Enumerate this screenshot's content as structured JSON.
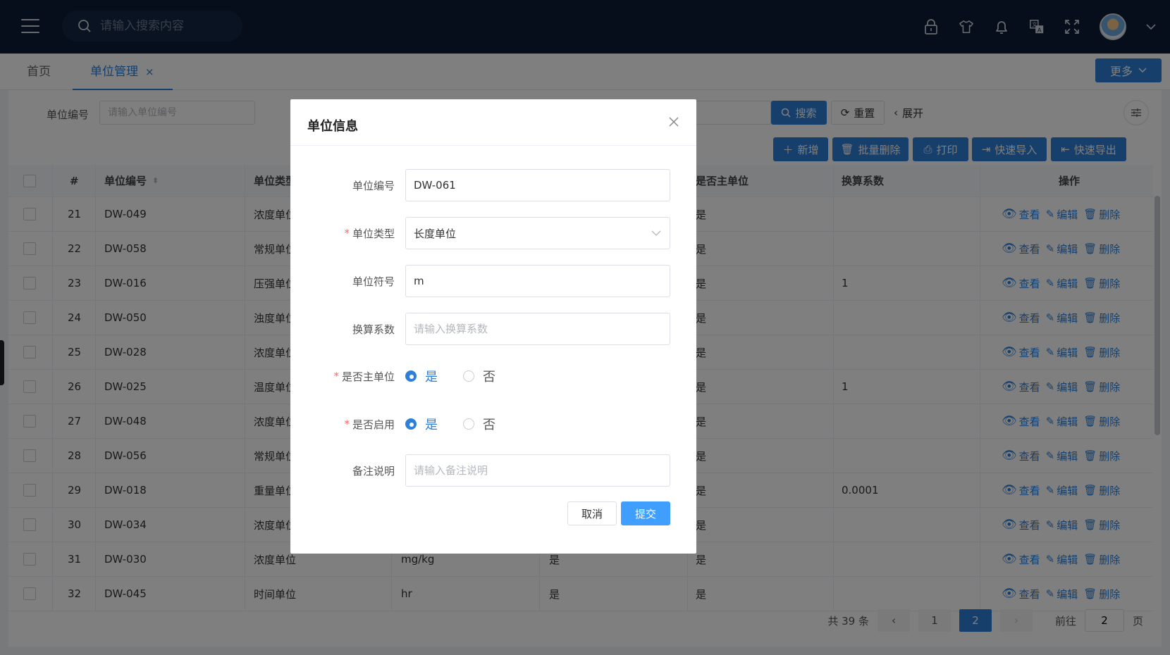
{
  "header": {
    "search_placeholder": "请输入搜索内容",
    "icons": [
      "lock-icon",
      "shirt-icon",
      "bell-icon",
      "translate-icon",
      "fullscreen-icon"
    ]
  },
  "tabs": [
    {
      "label": "首页"
    },
    {
      "label": "单位管理",
      "active": true
    }
  ],
  "tabs_more": "更多",
  "filter": {
    "code_label": "单位编号",
    "code_placeholder": "请输入单位编号",
    "search": "搜索",
    "reset": "重置",
    "expand": "展开"
  },
  "toolbar": {
    "add": "新增",
    "batch_delete": "批量删除",
    "print": "打印",
    "quick_import": "快速导入",
    "quick_export": "快速导出"
  },
  "table": {
    "headers": {
      "index": "#",
      "code": "单位编号",
      "type": "单位类型",
      "main": "是否主单位",
      "factor": "换算系数",
      "ops": "操作"
    },
    "actions": {
      "view": "查看",
      "edit": "编辑",
      "delete": "删除"
    },
    "rows": [
      {
        "index": "21",
        "code": "DW-049",
        "type": "浓度单位",
        "symbol": "",
        "enabled": "",
        "main": "是",
        "factor": ""
      },
      {
        "index": "22",
        "code": "DW-058",
        "type": "常规单位",
        "symbol": "",
        "enabled": "",
        "main": "是",
        "factor": ""
      },
      {
        "index": "23",
        "code": "DW-016",
        "type": "压强单位",
        "symbol": "",
        "enabled": "",
        "main": "是",
        "factor": "1"
      },
      {
        "index": "24",
        "code": "DW-050",
        "type": "浊度单位",
        "symbol": "",
        "enabled": "",
        "main": "是",
        "factor": ""
      },
      {
        "index": "25",
        "code": "DW-028",
        "type": "浓度单位",
        "symbol": "",
        "enabled": "",
        "main": "是",
        "factor": ""
      },
      {
        "index": "26",
        "code": "DW-025",
        "type": "温度单位",
        "symbol": "",
        "enabled": "",
        "main": "是",
        "factor": "1"
      },
      {
        "index": "27",
        "code": "DW-048",
        "type": "浓度单位",
        "symbol": "",
        "enabled": "",
        "main": "是",
        "factor": ""
      },
      {
        "index": "28",
        "code": "DW-056",
        "type": "常规单位",
        "symbol": "",
        "enabled": "",
        "main": "是",
        "factor": ""
      },
      {
        "index": "29",
        "code": "DW-018",
        "type": "重量单位",
        "symbol": "",
        "enabled": "",
        "main": "是",
        "factor": "0.0001"
      },
      {
        "index": "30",
        "code": "DW-034",
        "type": "浓度单位",
        "symbol": "",
        "enabled": "",
        "main": "是",
        "factor": ""
      },
      {
        "index": "31",
        "code": "DW-030",
        "type": "浓度单位",
        "symbol": "mg/kg",
        "enabled": "是",
        "main": "是",
        "factor": ""
      },
      {
        "index": "32",
        "code": "DW-045",
        "type": "时间单位",
        "symbol": "hr",
        "enabled": "是",
        "main": "是",
        "factor": ""
      }
    ]
  },
  "pagination": {
    "total": "共 39 条",
    "pages": [
      "1",
      "2"
    ],
    "current": "2",
    "goto_prefix": "前往",
    "goto_value": "2",
    "goto_suffix": "页"
  },
  "modal": {
    "title": "单位信息",
    "fields": {
      "code_label": "单位编号",
      "code_value": "DW-061",
      "type_label": "单位类型",
      "type_value": "长度单位",
      "symbol_label": "单位符号",
      "symbol_value": "m",
      "factor_label": "换算系数",
      "factor_placeholder": "请输入换算系数",
      "main_label": "是否主单位",
      "enabled_label": "是否启用",
      "yes": "是",
      "no": "否",
      "remark_label": "备注说明",
      "remark_placeholder": "请输入备注说明"
    },
    "cancel": "取消",
    "submit": "提交"
  },
  "colors": {
    "primary": "#2d7fd7",
    "header_bg": "#0c1d36",
    "required": "#f56c6c"
  }
}
